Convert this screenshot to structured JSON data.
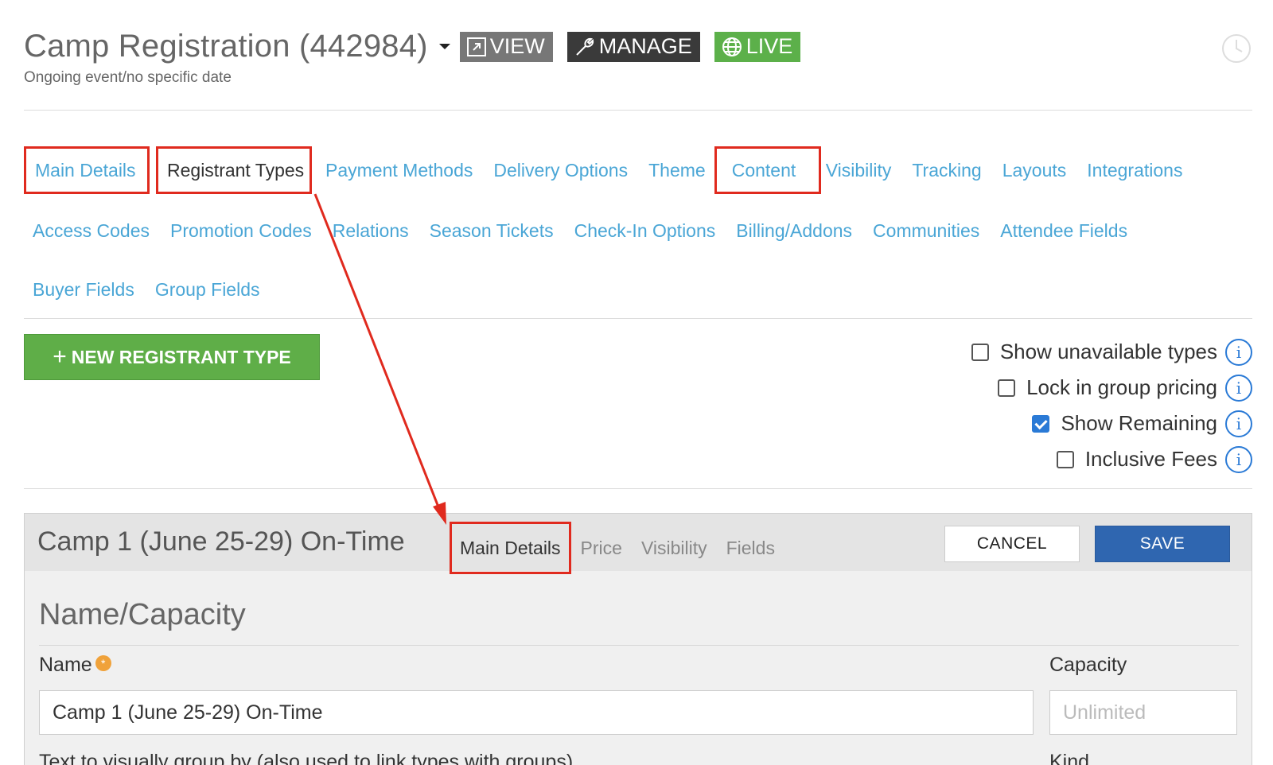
{
  "header": {
    "title": "Camp Registration (442984)",
    "subtitle": "Ongoing event/no specific date",
    "view_label": "VIEW",
    "manage_label": "MANAGE",
    "live_label": "LIVE"
  },
  "tabs": {
    "row1": [
      "Main Details",
      "Registrant Types",
      "Payment Methods",
      "Delivery Options",
      "Theme",
      "Content",
      "Visibility",
      "Tracking",
      "Layouts",
      "Integrations"
    ],
    "row2": [
      "Access Codes",
      "Promotion Codes",
      "Relations",
      "Season Tickets",
      "Check-In Options",
      "Billing/Addons",
      "Communities",
      "Attendee Fields"
    ],
    "row3": [
      "Buyer Fields",
      "Group Fields"
    ]
  },
  "toolbar": {
    "new_type_label": "NEW REGISTRANT TYPE"
  },
  "options": [
    {
      "label": "Show unavailable types",
      "checked": false
    },
    {
      "label": "Lock in group pricing",
      "checked": false
    },
    {
      "label": "Show Remaining",
      "checked": true
    },
    {
      "label": "Inclusive Fees",
      "checked": false
    }
  ],
  "panel": {
    "type_title": "Camp 1 (June 25-29) On-Time",
    "sub_tabs": [
      "Main Details",
      "Price",
      "Visibility",
      "Fields"
    ],
    "cancel_label": "CANCEL",
    "save_label": "SAVE",
    "section_title": "Name/Capacity",
    "name_label": "Name",
    "name_value": "Camp 1 (June 25-29) On-Time",
    "capacity_label": "Capacity",
    "capacity_placeholder": "Unlimited",
    "group_label": "Text to visually group by (also used to link types with groups)",
    "kind_label": "Kind"
  },
  "colors": {
    "link": "#4aa6d6",
    "highlight": "#e02a1e",
    "live": "#5cb04a",
    "save": "#2f66b0"
  }
}
